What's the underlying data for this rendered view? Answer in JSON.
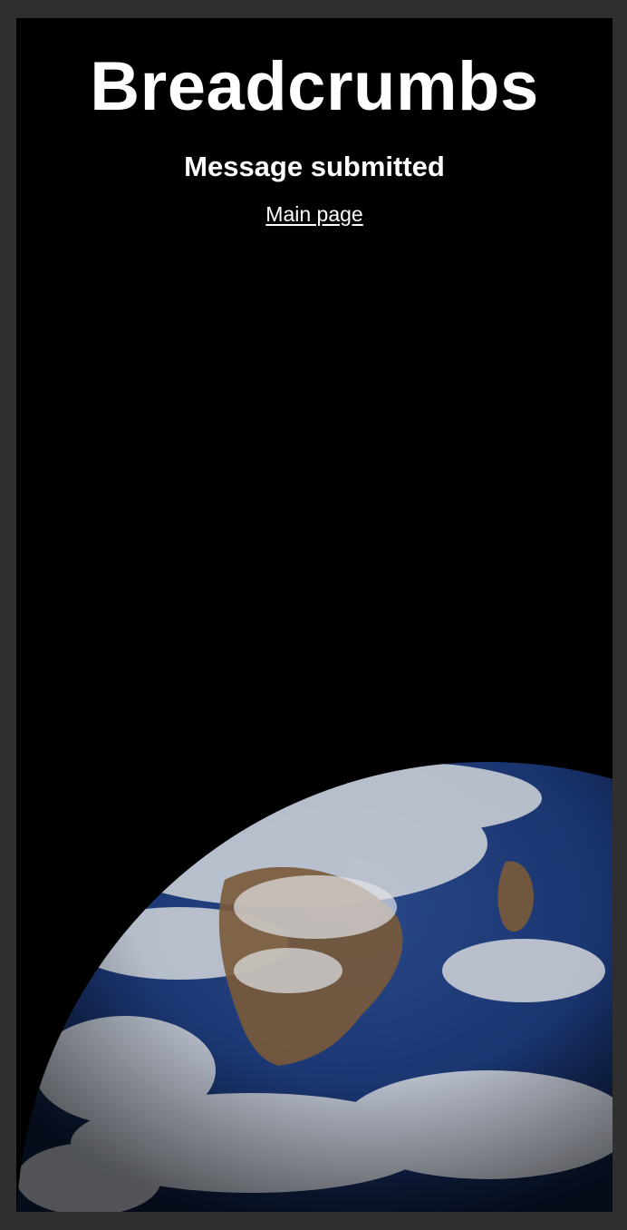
{
  "header": {
    "title": "Breadcrumbs"
  },
  "main": {
    "status_message": "Message submitted",
    "main_page_link": "Main page"
  },
  "background": {
    "image": "earth-from-space",
    "colors": {
      "page_border": "#2f2f2f",
      "frame": "#000000",
      "ocean": "#14306e",
      "cloud": "#d9dce0",
      "land": "#7a5a3a"
    }
  }
}
